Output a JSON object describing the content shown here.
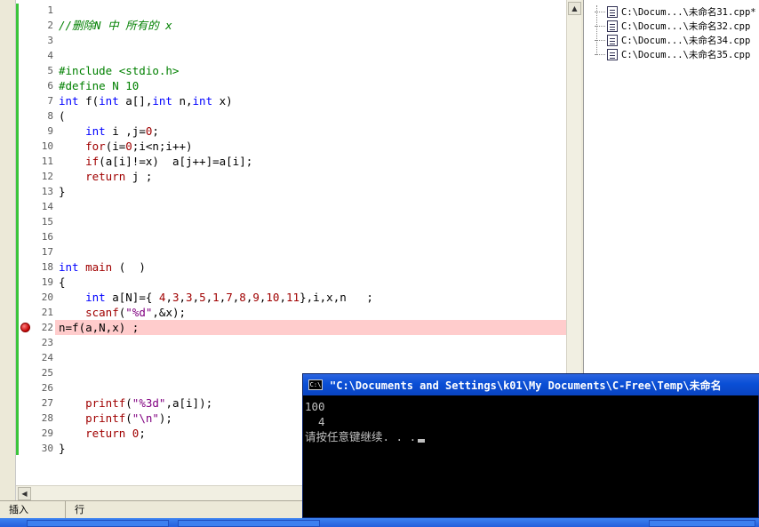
{
  "editor": {
    "line_numbers": [
      "1",
      "2",
      "3",
      "4",
      "5",
      "6",
      "7",
      "8",
      "9",
      "10",
      "11",
      "12",
      "13",
      "14",
      "15",
      "16",
      "17",
      "18",
      "19",
      "20",
      "21",
      "22",
      "23",
      "24",
      "25",
      "26",
      "27",
      "28",
      "29",
      "30"
    ],
    "code_lines": [
      [],
      [
        {
          "t": "//删除N 中 所有的 x",
          "c": "cmt"
        }
      ],
      [],
      [],
      [
        {
          "t": "#include <stdio.h>",
          "c": "pp"
        }
      ],
      [
        {
          "t": "#define N 10",
          "c": "pp"
        }
      ],
      [
        {
          "t": "int",
          "c": "kw"
        },
        {
          "t": " f(",
          "c": "sym"
        },
        {
          "t": "int",
          "c": "kw"
        },
        {
          "t": " a[],",
          "c": "var"
        },
        {
          "t": "int",
          "c": "kw"
        },
        {
          "t": " n,",
          "c": "var"
        },
        {
          "t": "int",
          "c": "kw"
        },
        {
          "t": " x)",
          "c": "var"
        }
      ],
      [
        {
          "t": "(",
          "c": "sym"
        }
      ],
      [
        {
          "t": "    ",
          "c": "sym"
        },
        {
          "t": "int",
          "c": "kw"
        },
        {
          "t": " i ,j=",
          "c": "var"
        },
        {
          "t": "0",
          "c": "num"
        },
        {
          "t": ";",
          "c": "sym"
        }
      ],
      [
        {
          "t": "    ",
          "c": "sym"
        },
        {
          "t": "for",
          "c": "fn"
        },
        {
          "t": "(i=",
          "c": "var"
        },
        {
          "t": "0",
          "c": "num"
        },
        {
          "t": ";i<n;i++)",
          "c": "var"
        }
      ],
      [
        {
          "t": "    ",
          "c": "sym"
        },
        {
          "t": "if",
          "c": "fn"
        },
        {
          "t": "(a[i]!=x)  a[j++]=a[i];",
          "c": "var"
        }
      ],
      [
        {
          "t": "    ",
          "c": "sym"
        },
        {
          "t": "return",
          "c": "fn"
        },
        {
          "t": " j ;",
          "c": "var"
        }
      ],
      [
        {
          "t": "}",
          "c": "sym"
        }
      ],
      [],
      [],
      [],
      [],
      [
        {
          "t": "int",
          "c": "kw"
        },
        {
          "t": " main",
          "c": "fn"
        },
        {
          "t": " (  )",
          "c": "sym"
        }
      ],
      [
        {
          "t": "{",
          "c": "sym"
        }
      ],
      [
        {
          "t": "    ",
          "c": "sym"
        },
        {
          "t": "int",
          "c": "kw"
        },
        {
          "t": " a[N]={ ",
          "c": "var"
        },
        {
          "t": "4",
          "c": "num"
        },
        {
          "t": ",",
          "c": "sym"
        },
        {
          "t": "3",
          "c": "num"
        },
        {
          "t": ",",
          "c": "sym"
        },
        {
          "t": "3",
          "c": "num"
        },
        {
          "t": ",",
          "c": "sym"
        },
        {
          "t": "5",
          "c": "num"
        },
        {
          "t": ",",
          "c": "sym"
        },
        {
          "t": "1",
          "c": "num"
        },
        {
          "t": ",",
          "c": "sym"
        },
        {
          "t": "7",
          "c": "num"
        },
        {
          "t": ",",
          "c": "sym"
        },
        {
          "t": "8",
          "c": "num"
        },
        {
          "t": ",",
          "c": "sym"
        },
        {
          "t": "9",
          "c": "num"
        },
        {
          "t": ",",
          "c": "sym"
        },
        {
          "t": "10",
          "c": "num"
        },
        {
          "t": ",",
          "c": "sym"
        },
        {
          "t": "11",
          "c": "num"
        },
        {
          "t": "},i,x,n   ;",
          "c": "var"
        }
      ],
      [
        {
          "t": "    ",
          "c": "sym"
        },
        {
          "t": "scanf",
          "c": "fn"
        },
        {
          "t": "(",
          "c": "sym"
        },
        {
          "t": "\"%d\"",
          "c": "str"
        },
        {
          "t": ",&x);",
          "c": "var"
        }
      ],
      [
        {
          "t": "n=f(a,N,x) ;",
          "c": "var"
        }
      ],
      [],
      [],
      [],
      [],
      [
        {
          "t": "    ",
          "c": "sym"
        },
        {
          "t": "printf",
          "c": "fn"
        },
        {
          "t": "(",
          "c": "sym"
        },
        {
          "t": "\"%3d\"",
          "c": "str"
        },
        {
          "t": ",a[i]);",
          "c": "var"
        }
      ],
      [
        {
          "t": "    ",
          "c": "sym"
        },
        {
          "t": "printf",
          "c": "fn"
        },
        {
          "t": "(",
          "c": "sym"
        },
        {
          "t": "\"\\n\"",
          "c": "str"
        },
        {
          "t": ");",
          "c": "sym"
        }
      ],
      [
        {
          "t": "    ",
          "c": "sym"
        },
        {
          "t": "return",
          "c": "fn"
        },
        {
          "t": " ",
          "c": "sym"
        },
        {
          "t": "0",
          "c": "num"
        },
        {
          "t": ";",
          "c": "sym"
        }
      ],
      [
        {
          "t": "}",
          "c": "sym"
        }
      ]
    ],
    "breakpoint_line": "22",
    "highlighted_line": "22"
  },
  "files": [
    {
      "label": "C:\\Docum...\\未命名31.cpp*"
    },
    {
      "label": "C:\\Docum...\\未命名32.cpp"
    },
    {
      "label": "C:\\Docum...\\未命名34.cpp"
    },
    {
      "label": "C:\\Docum...\\未命名35.cpp"
    }
  ],
  "console": {
    "icon_text": "C:\\",
    "title": "\"C:\\Documents and Settings\\k01\\My Documents\\C-Free\\Temp\\未命名",
    "lines": [
      "100",
      "  4",
      "请按任意键继续. . ."
    ]
  },
  "status": {
    "mode": "插入",
    "row_label": "行"
  },
  "colors": {
    "highlight": "#ffcccc",
    "keyword": "#0000ff",
    "function": "#a00000",
    "comment": "#008000",
    "string": "#800080"
  }
}
